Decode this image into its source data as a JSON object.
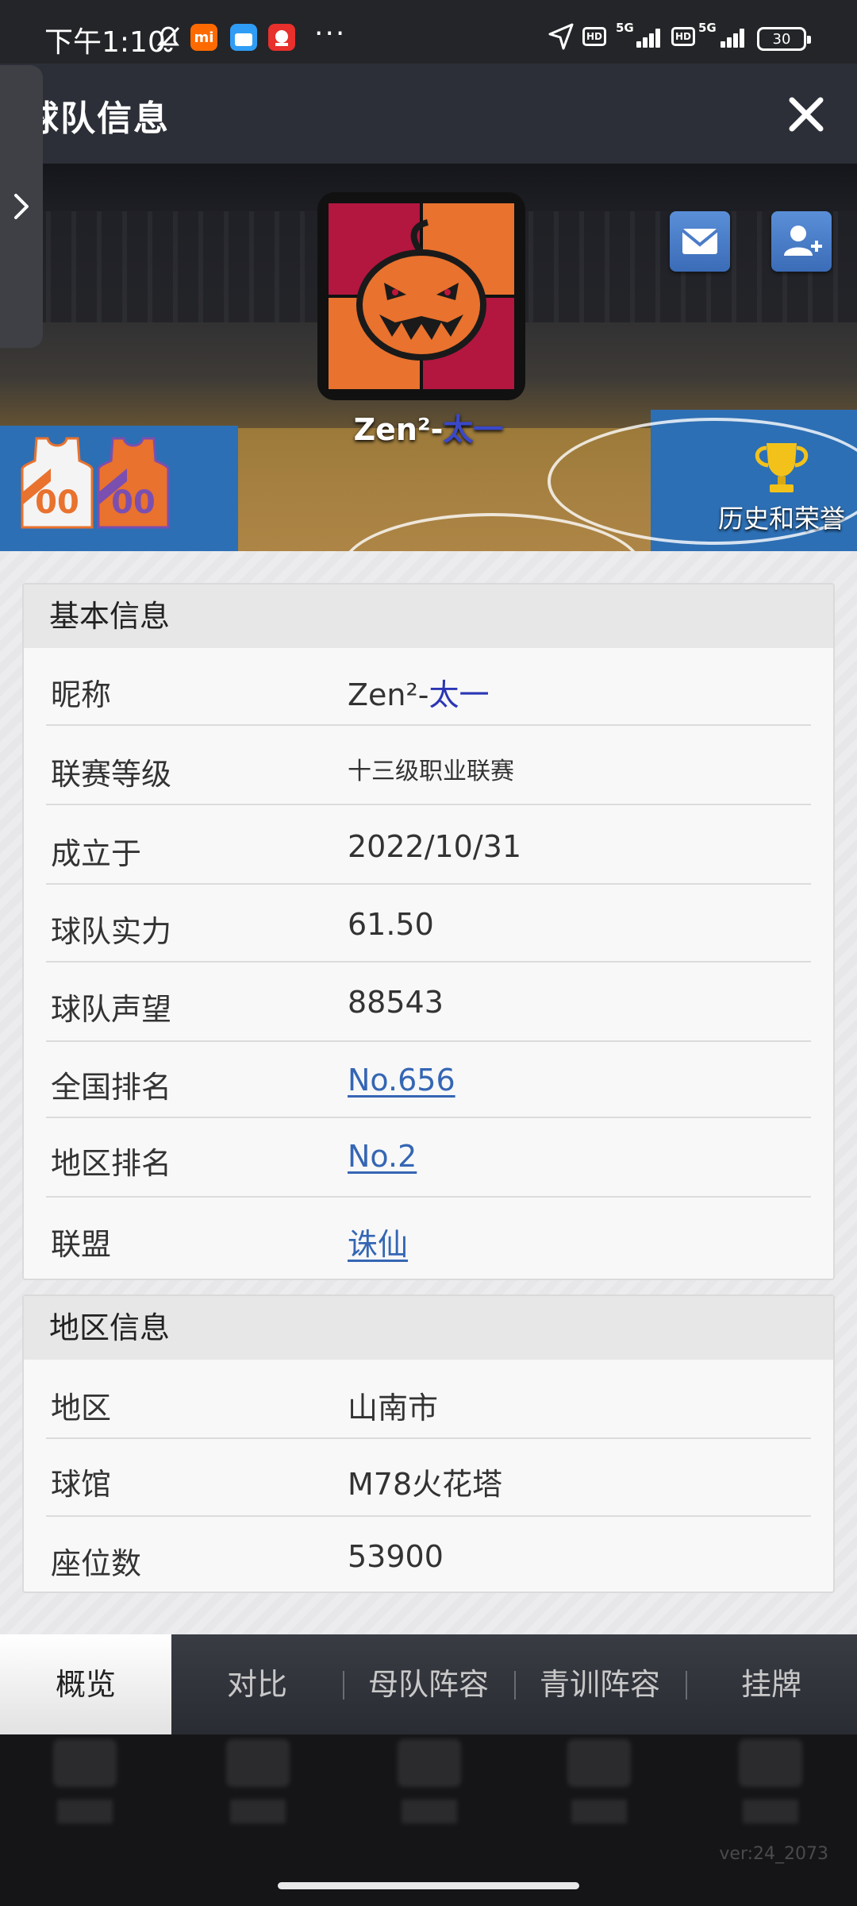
{
  "status_bar": {
    "time": "下午1:10",
    "mi_icon_text": "mi",
    "network_1": "5G",
    "network_2": "5G",
    "hd_1": "HD",
    "hd_2": "HD",
    "battery": "30",
    "more": "···"
  },
  "header": {
    "title": "球队信息"
  },
  "banner": {
    "team_name_main": "Zen²-",
    "team_name_accent": "太一",
    "jersey_home_number": "00",
    "jersey_away_number": "00",
    "honors_label": "历史和荣誉"
  },
  "basic_info": {
    "header": "基本信息",
    "rows": [
      {
        "label": "昵称",
        "value_main": "Zen²-",
        "value_accent": "太一"
      },
      {
        "label": "联赛等级",
        "value": "十三级职业联赛"
      },
      {
        "label": "成立于",
        "value": "2022/10/31"
      },
      {
        "label": "球队实力",
        "value": "61.50"
      },
      {
        "label": "球队声望",
        "value": "88543"
      },
      {
        "label": "全国排名",
        "value": "No.656"
      },
      {
        "label": "地区排名",
        "value": "No.2"
      },
      {
        "label": "联盟",
        "value": "诛仙"
      }
    ]
  },
  "region_info": {
    "header": "地区信息",
    "rows": [
      {
        "label": "地区",
        "value": "山南市"
      },
      {
        "label": "球馆",
        "value": "M78火花塔"
      },
      {
        "label": "座位数",
        "value": "53900"
      }
    ]
  },
  "tabs": [
    {
      "label": "概览",
      "active": true
    },
    {
      "label": "对比"
    },
    {
      "label": "母队阵容"
    },
    {
      "label": "青训阵容"
    },
    {
      "label": "挂牌"
    }
  ],
  "footer": {
    "version": "ver:24_2073"
  },
  "colors": {
    "accent_text": "#2a36b4",
    "link": "#3566b4",
    "logo_orange": "#e8722e",
    "logo_crimson": "#b3163f"
  },
  "icons": [
    "bell-off-icon",
    "location-icon",
    "close-icon",
    "chevron-right-icon",
    "mail-icon",
    "add-friend-icon",
    "trophy-icon",
    "pumpkin-logo"
  ]
}
